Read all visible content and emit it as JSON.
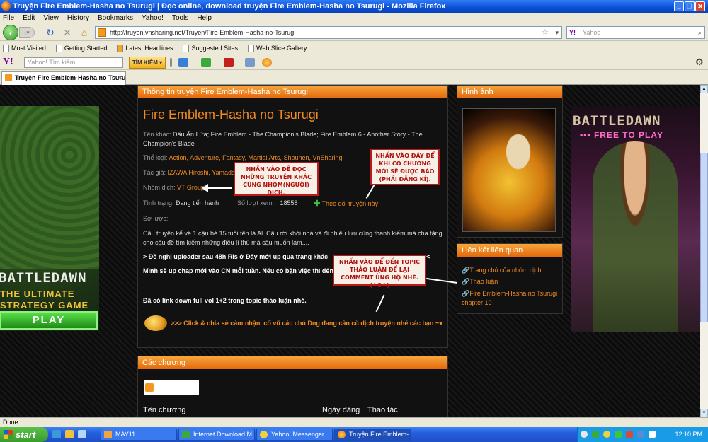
{
  "window": {
    "title": "Truyện Fire Emblem-Hasha no Tsurugi | Đọc online, download truyện Fire Emblem-Hasha no Tsurugi - Mozilla Firefox"
  },
  "menu": [
    "File",
    "Edit",
    "View",
    "History",
    "Bookmarks",
    "Yahoo!",
    "Tools",
    "Help"
  ],
  "nav": {
    "url": "http://truyen.vnsharing.net/Truyen/Fire-Emblem-Hasha-no-Tsurug",
    "search_placeholder": "Yahoo"
  },
  "bookmarks": [
    "Most Visited",
    "Getting Started",
    "Latest Headlines",
    "Suggested Sites",
    "Web Slice Gallery"
  ],
  "yahoo_toolbar": {
    "logo": "Y!",
    "search_placeholder": "Yahoo! Tìm kiếm",
    "search_button": "TÌM KIẾM"
  },
  "tab": {
    "label": "Truyện Fire Emblem-Hasha no Tsuru..."
  },
  "manga": {
    "section_title": "Thông tin truyện Fire Emblem-Hasha no Tsurugi",
    "title": "Fire Emblem-Hasha no Tsurugi",
    "other_names_label": "Tên khác:",
    "other_names": "Dấu Ấn Lửa; Fire Emblem - The Champion's Blade; Fire Emblem 6 - Another Story - The Champion's Blade",
    "genre_label": "Thể loại:",
    "genres": "Action, Adventure, Fantasy, Martial Arts, Shounen, VnSharing",
    "author_label": "Tác giả:",
    "authors": "IZAWA Hiroshi, Yamada Ko",
    "translator_label": "Nhóm dịch:",
    "translator": "VT Group",
    "status_label": "Tình trạng:",
    "status": "Đang tiến hành",
    "views_label": "Số lượt xem:",
    "views": "18558",
    "follow": "Theo dõi truyện này",
    "summary_label": "Sơ lược:",
    "summary": "Câu truyện kể về 1 cậu bé 15 tuổi tên là Al. Cậu rời khỏi nhà và đi phiêu lưu cùng thanh kiếm mà cha tặng cho cậu để tìm kiếm những điều lí thú mà cậu muốn làm....",
    "line1": "> Đề nghị uploader sau 48h Rls ở Đây mới up qua trang khác",
    "line1_tail": "<",
    "line2": "Mình sẽ up chap mới vào CN mỗi tuần. Nếu có bận việc thì đến",
    "line3": "Đã có link down full vol 1+2 trong topic thảo luận nhé.",
    "share": ">>> Click & chia sẻ cảm nhận, cổ vũ các chú Dng đang cần cù dịch truyện nhé các bạn ~♥"
  },
  "notes": {
    "n1": "Nhấn vào để đọc những truyện khác cùng nhóm(người) dịch.",
    "n2": "Nhấn vào đây để khi có chương mới sẽ được báo (phải đăng kí).",
    "n3": "Nhấn vào để đến topic thảo luận để lại comment ủng hộ nhé. (^o^)"
  },
  "chapters": {
    "section_title": "Các chương",
    "col_name": "Tên chương",
    "col_date": "Ngày đăng",
    "col_action": "Thao tác"
  },
  "sidebar": {
    "images_title": "Hình ảnh",
    "links_title": "Liên kết liên quan",
    "links": [
      "Trang chủ của nhóm dịch",
      "Thảo luận",
      "Fire Emblem-Hasha no Tsurugi chapter 10"
    ]
  },
  "ads": {
    "left_logo": "BATTLEDAWN",
    "left_tag1": "THE ULTIMATE",
    "left_tag2": "STRATEGY GAME",
    "left_play": "PLAY",
    "right_logo": "BATTLEDAWN",
    "right_tag": "••• FREE TO PLAY"
  },
  "status_bar": "Done",
  "taskbar": {
    "start": "start",
    "items": [
      "MAY11",
      "Internet Download M...",
      "Yahoo! Messenger",
      "Truyện Fire Emblem-..."
    ],
    "clock": "12:10 PM"
  }
}
